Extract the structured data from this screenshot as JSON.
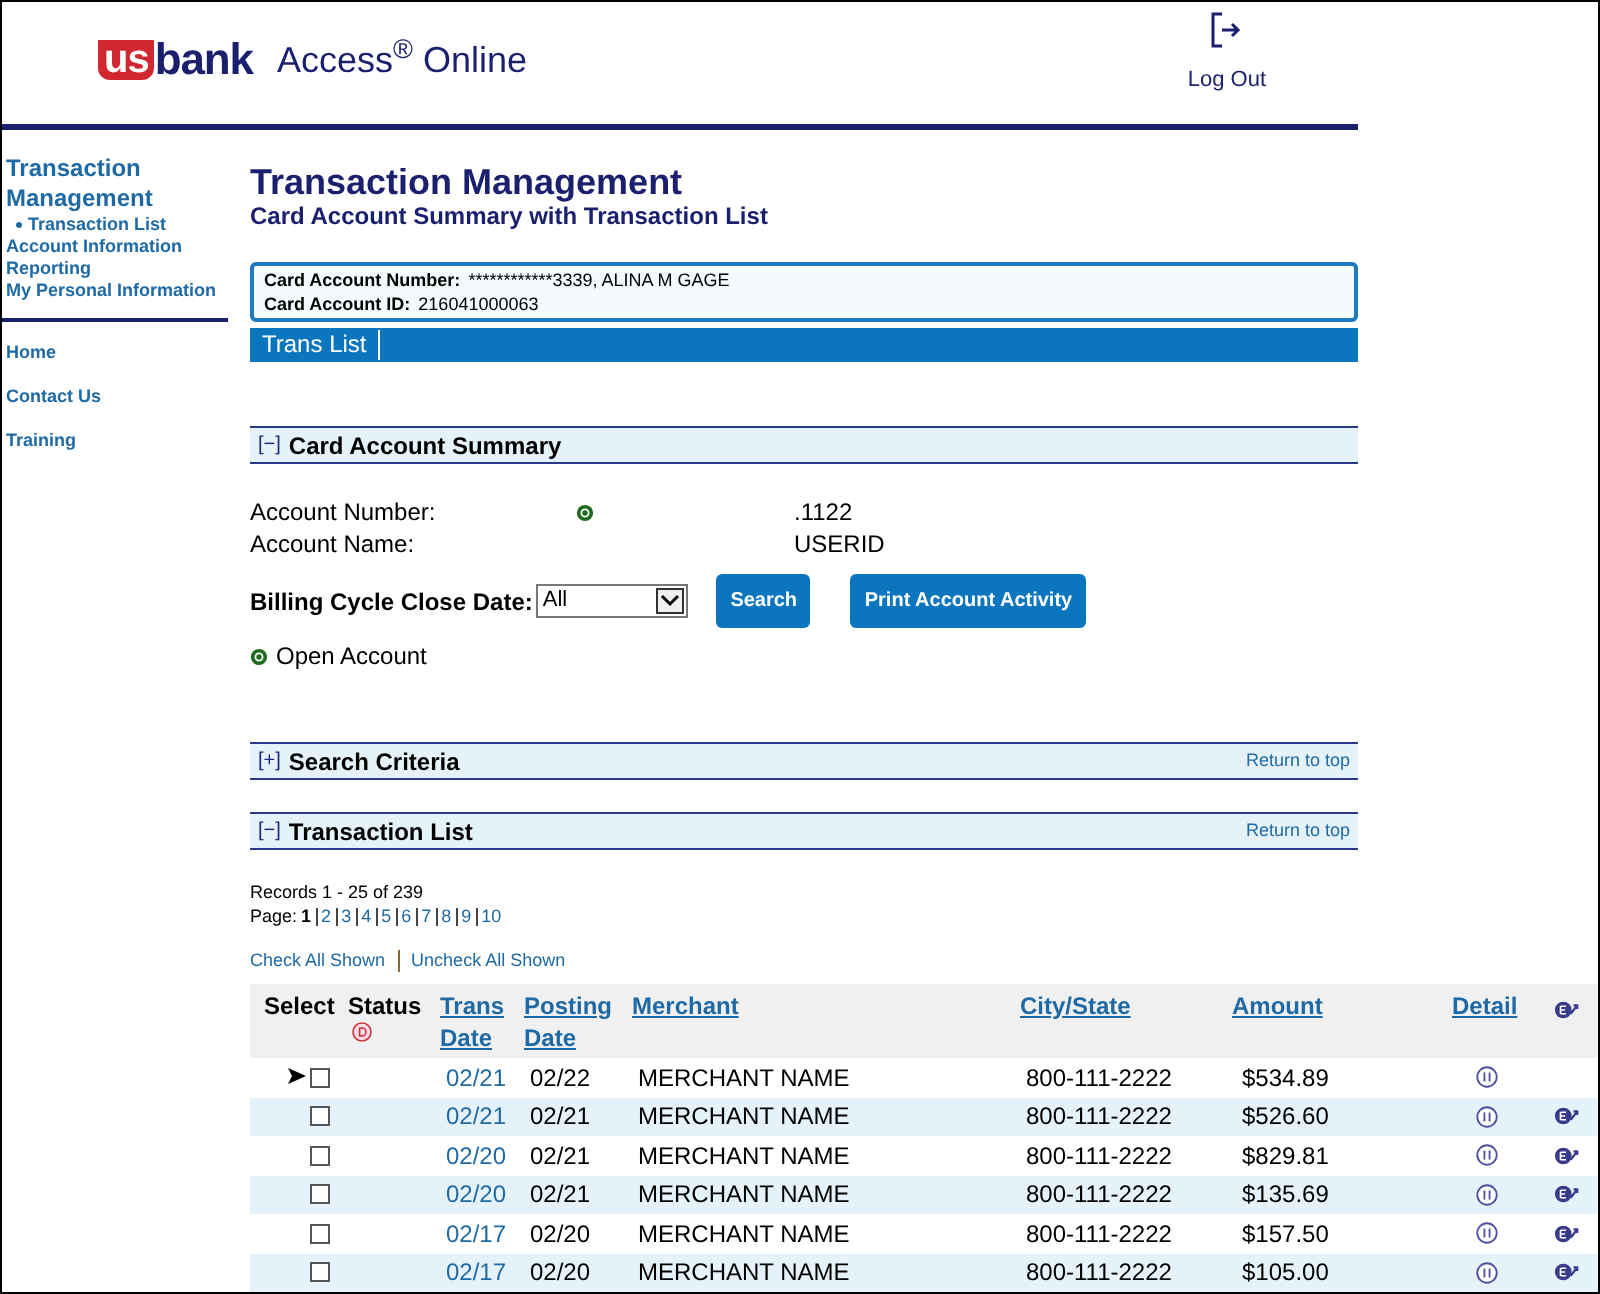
{
  "header": {
    "logo": {
      "us": "us",
      "bank": "bank"
    },
    "product": "Access$^{®}$ Online",
    "logout": "Log Out"
  },
  "sidebar": {
    "items": [
      {
        "label": "Transaction Management",
        "kind": "heading",
        "children": [
          {
            "label": "Transaction List"
          }
        ]
      },
      {
        "label": "Account Information",
        "kind": "link"
      },
      {
        "label": "Reporting",
        "kind": "link"
      },
      {
        "label": "My Personal Information",
        "kind": "link"
      }
    ],
    "bottom_links": [
      "Home",
      "Contact Us",
      "Training"
    ]
  },
  "page": {
    "title": "Transaction Management",
    "subtitle": "Card Account Summary with Transaction List"
  },
  "card_info": [
    {
      "label": "Card Account Number:",
      "value": "************3339, ALINA M GAGE"
    },
    {
      "label": "Card Account ID:",
      "value": "216041000063"
    }
  ],
  "tabs": [
    {
      "label": "Trans List",
      "selected": true
    }
  ],
  "summary": {
    "toggle": "[−]",
    "title": "Card Account Summary",
    "fields": [
      {
        "label": "Account Number:",
        "status_dot": true,
        "value": ".1122"
      },
      {
        "label": "Account Name:",
        "status_dot": false,
        "value": "USERID"
      }
    ],
    "billing_label": "Billing Cycle Close Date:",
    "billing_value": "All",
    "buttons": [
      "Search",
      "Print Account Activity"
    ],
    "legend": "Open Account"
  },
  "search_criteria": {
    "toggle": "[+]",
    "title": "Search Criteria",
    "return_link": "Return to top"
  },
  "transaction_list": {
    "toggle": "[−]",
    "title": "Transaction List",
    "return_link": "Return to top",
    "records": "Records 1 - 25 of 239",
    "page_label": "Page:",
    "pages": [
      {
        "label": "1",
        "selected": true
      },
      {
        "label": "2",
        "selected": false
      },
      {
        "label": "3",
        "selected": false
      },
      {
        "label": "4",
        "selected": false
      },
      {
        "label": "5",
        "selected": false
      },
      {
        "label": "6",
        "selected": false
      },
      {
        "label": "7",
        "selected": false
      },
      {
        "label": "8",
        "selected": false
      },
      {
        "label": "9",
        "selected": false
      },
      {
        "label": "10",
        "selected": false
      }
    ],
    "check_all": "Check All Shown",
    "uncheck_all": "Uncheck All Shown"
  },
  "table": {
    "columns": [
      {
        "label": "Select",
        "link": false
      },
      {
        "label": "Status",
        "link": false
      },
      {
        "label": "Trans Date",
        "link": true
      },
      {
        "label": "Posting Date",
        "link": true
      },
      {
        "label": "Merchant",
        "link": true
      },
      {
        "label": "City/State",
        "link": true
      },
      {
        "label": "Amount",
        "link": true
      },
      {
        "label": "Detail",
        "link": true
      }
    ],
    "rows": [
      {
        "current": true,
        "checked": false,
        "trans_date": "02/21",
        "posting_date": "02/22",
        "merchant": "MERCHANT NAME",
        "city_state": "800-111-2222",
        "amount": "$534.89",
        "exportable": false
      },
      {
        "current": false,
        "checked": false,
        "trans_date": "02/21",
        "posting_date": "02/21",
        "merchant": "MERCHANT NAME",
        "city_state": "800-111-2222",
        "amount": "$526.60",
        "exportable": true
      },
      {
        "current": false,
        "checked": false,
        "trans_date": "02/20",
        "posting_date": "02/21",
        "merchant": "MERCHANT NAME",
        "city_state": "800-111-2222",
        "amount": "$829.81",
        "exportable": true
      },
      {
        "current": false,
        "checked": false,
        "trans_date": "02/20",
        "posting_date": "02/21",
        "merchant": "MERCHANT NAME",
        "city_state": "800-111-2222",
        "amount": "$135.69",
        "exportable": true
      },
      {
        "current": false,
        "checked": false,
        "trans_date": "02/17",
        "posting_date": "02/20",
        "merchant": "MERCHANT NAME",
        "city_state": "800-111-2222",
        "amount": "$157.50",
        "exportable": true
      },
      {
        "current": false,
        "checked": false,
        "trans_date": "02/17",
        "posting_date": "02/20",
        "merchant": "MERCHANT NAME",
        "city_state": "800-111-2222",
        "amount": "$105.00",
        "exportable": true
      }
    ]
  }
}
